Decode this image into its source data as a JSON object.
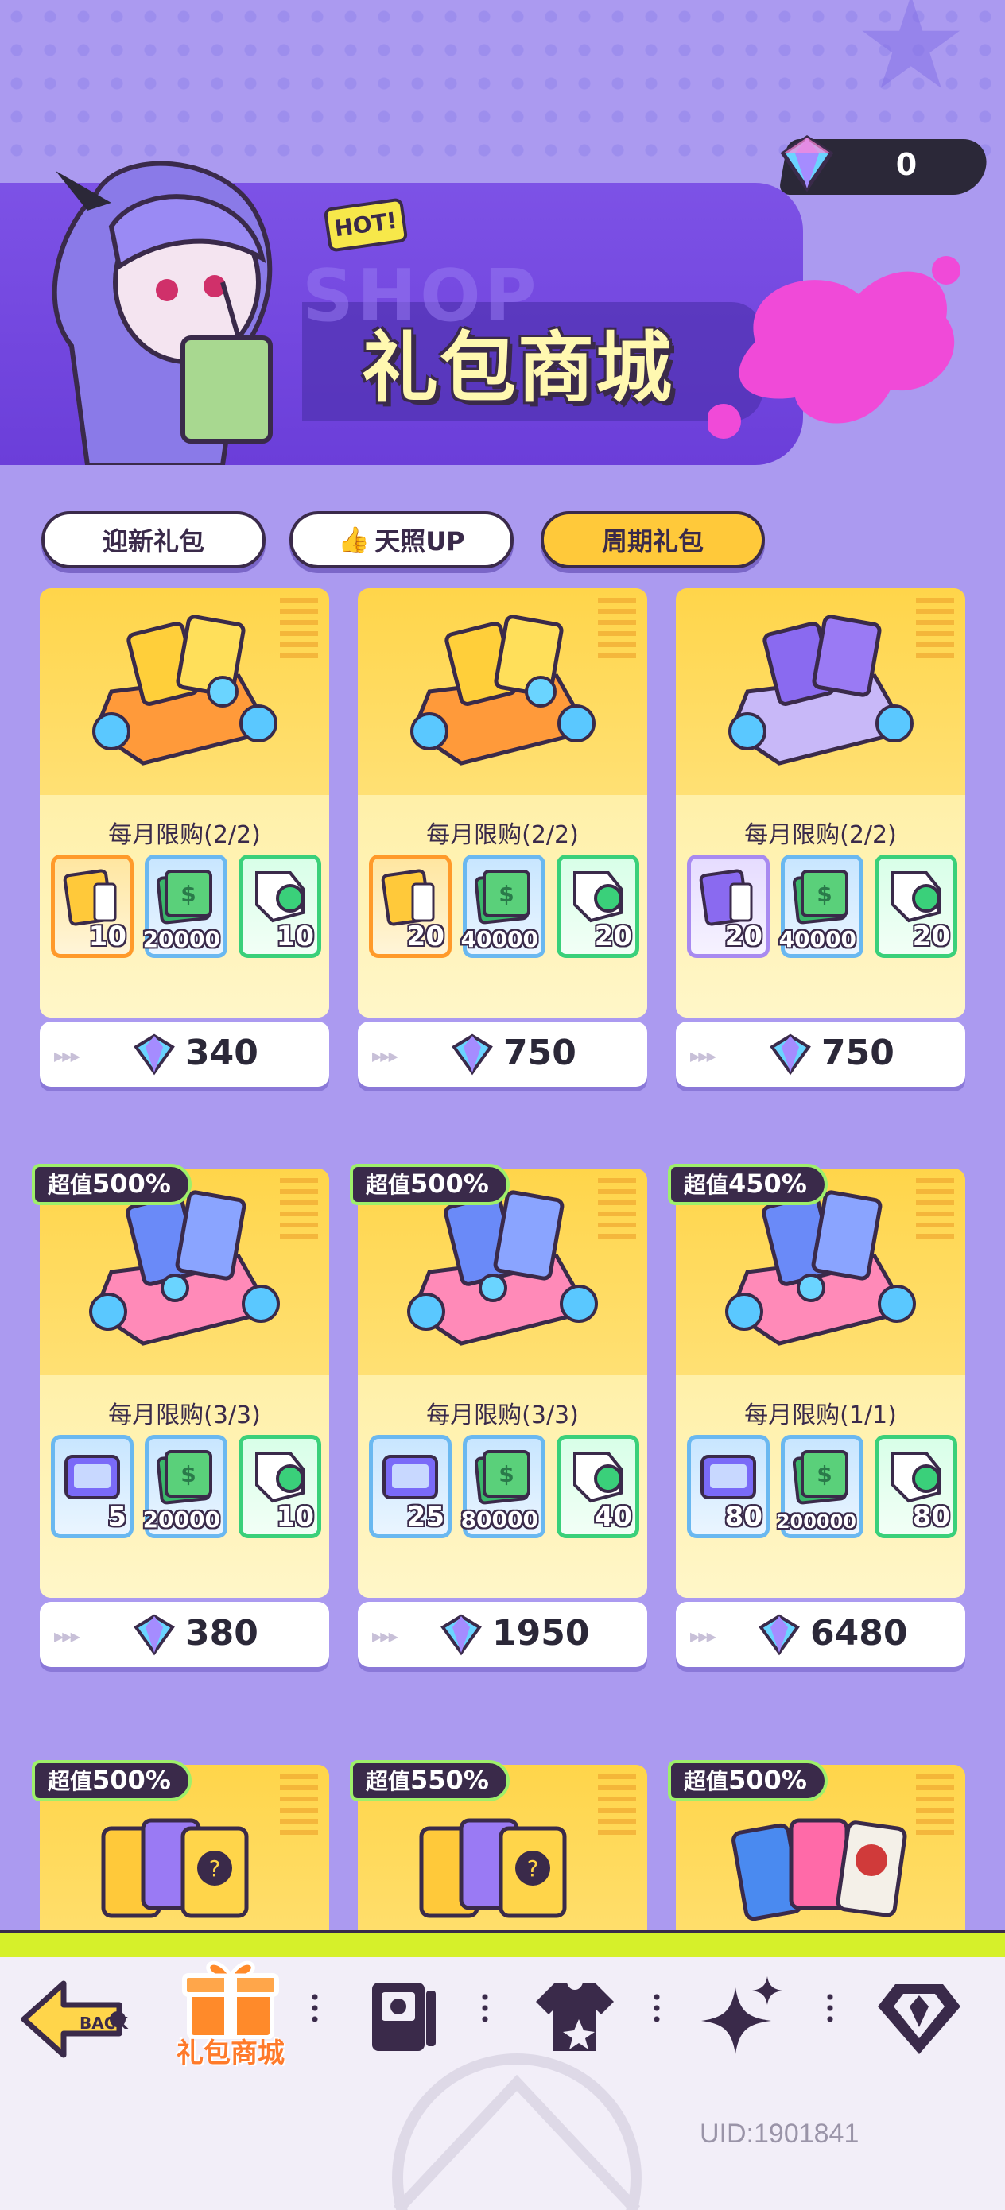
{
  "header": {
    "currency_value": "0",
    "hot_badge": "HOT!",
    "banner_bg_text": "SHOP",
    "title": "礼包商城"
  },
  "tabs": [
    {
      "label": "迎新礼包",
      "active": false
    },
    {
      "label": "天照UP",
      "active": false,
      "icon": "thumbs-up-icon"
    },
    {
      "label": "周期礼包",
      "active": true
    }
  ],
  "cards": [
    {
      "limit": "每月限购(2/2)",
      "items": [
        {
          "type": "gold",
          "qty": "10"
        },
        {
          "type": "cash",
          "qty": "20000"
        },
        {
          "type": "token",
          "qty": "10"
        }
      ],
      "price": "340",
      "badge": null
    },
    {
      "limit": "每月限购(2/2)",
      "items": [
        {
          "type": "gold",
          "qty": "20"
        },
        {
          "type": "cash",
          "qty": "40000"
        },
        {
          "type": "token",
          "qty": "20"
        }
      ],
      "price": "750",
      "badge": null
    },
    {
      "limit": "每月限购(2/2)",
      "items": [
        {
          "type": "purple",
          "qty": "20"
        },
        {
          "type": "cash",
          "qty": "40000"
        },
        {
          "type": "token",
          "qty": "20"
        }
      ],
      "price": "750",
      "badge": null
    },
    {
      "limit": "每月限购(3/3)",
      "items": [
        {
          "type": "ticket",
          "qty": "5"
        },
        {
          "type": "cash",
          "qty": "20000"
        },
        {
          "type": "token",
          "qty": "10"
        }
      ],
      "price": "380",
      "badge": {
        "prefix": "超值",
        "pct": "500%"
      }
    },
    {
      "limit": "每月限购(3/3)",
      "items": [
        {
          "type": "ticket",
          "qty": "25"
        },
        {
          "type": "cash",
          "qty": "80000"
        },
        {
          "type": "token",
          "qty": "40"
        }
      ],
      "price": "1950",
      "badge": {
        "prefix": "超值",
        "pct": "500%"
      }
    },
    {
      "limit": "每月限购(1/1)",
      "items": [
        {
          "type": "ticket",
          "qty": "80"
        },
        {
          "type": "cash",
          "qty": "200000"
        },
        {
          "type": "token",
          "qty": "80"
        }
      ],
      "price": "6480",
      "badge": {
        "prefix": "超值",
        "pct": "450%"
      }
    },
    {
      "limit": "",
      "items": [],
      "price": "",
      "badge": {
        "prefix": "超值",
        "pct": "500%"
      }
    },
    {
      "limit": "",
      "items": [],
      "price": "",
      "badge": {
        "prefix": "超值",
        "pct": "550%"
      }
    },
    {
      "limit": "",
      "items": [],
      "price": "",
      "badge": {
        "prefix": "超值",
        "pct": "500%"
      }
    }
  ],
  "bottom_nav": {
    "back_label": "BACK",
    "shop_label": "礼包商城",
    "icons": [
      "back-icon",
      "gift-icon",
      "card-icon",
      "shirt-icon",
      "sparkle-icon",
      "diamond-icon"
    ]
  },
  "uid": "UID:1901841",
  "colors": {
    "background": "#ab9af0",
    "banner": "#6b3ed9",
    "active_tab": "#ffc93a",
    "lime": "#d6f02a",
    "accent_orange": "#ff7a2a"
  }
}
